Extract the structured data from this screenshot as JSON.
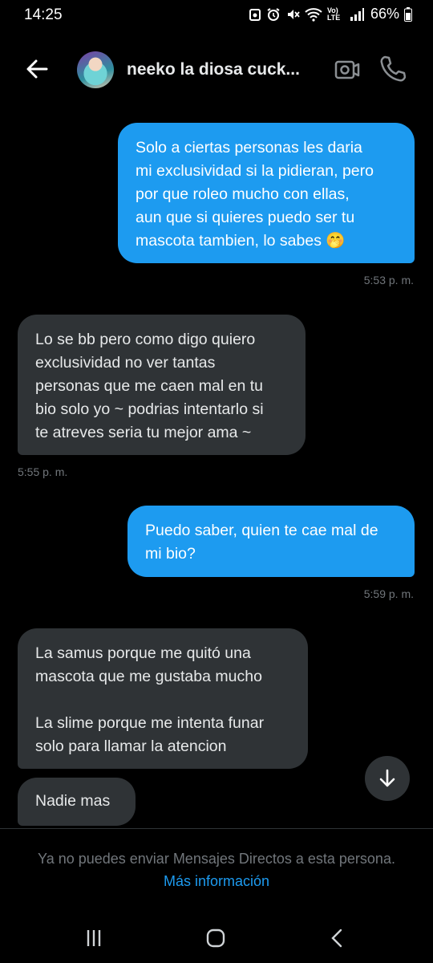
{
  "status_bar": {
    "time": "14:25",
    "network": "Vo) LTE",
    "battery": "66%"
  },
  "header": {
    "contact_name": "neeko la diosa cuck..."
  },
  "messages": [
    {
      "direction": "outgoing",
      "text": "Solo a ciertas personas les daria\nmi exclusividad si la pidieran, pero\npor que roleo mucho con ellas,\naun que si quieres puedo ser tu\nmascota tambien, lo sabes 🤭",
      "time": "5:53 p. m."
    },
    {
      "direction": "incoming",
      "text": "Lo se bb pero como digo quiero\nexclusividad no ver tantas\npersonas que me caen mal en tu\nbio solo yo ~ podrias intentarlo si\nte atreves seria tu mejor ama ~",
      "time": "5:55 p. m."
    },
    {
      "direction": "outgoing",
      "text": "Puedo saber, quien te cae mal de\nmi bio?",
      "time": "5:59 p. m."
    },
    {
      "direction": "incoming",
      "text": "La samus  porque me quitó una\nmascota que me gustaba mucho\n\nLa slime porque me intenta funar\nsolo para llamar la atencion"
    },
    {
      "direction": "incoming",
      "text": "Nadie mas"
    }
  ],
  "footer": {
    "notice": "Ya no puedes enviar Mensajes Directos a esta persona.",
    "link": "Más información"
  },
  "icons": {
    "back": "arrow-left-icon",
    "video": "video-camera-icon",
    "phone": "phone-icon",
    "scroll_down": "arrow-down-icon"
  },
  "colors": {
    "accent": "#1d9bf0",
    "incoming_bubble": "#2f3336",
    "background": "#000000",
    "muted_text": "#71767b"
  }
}
